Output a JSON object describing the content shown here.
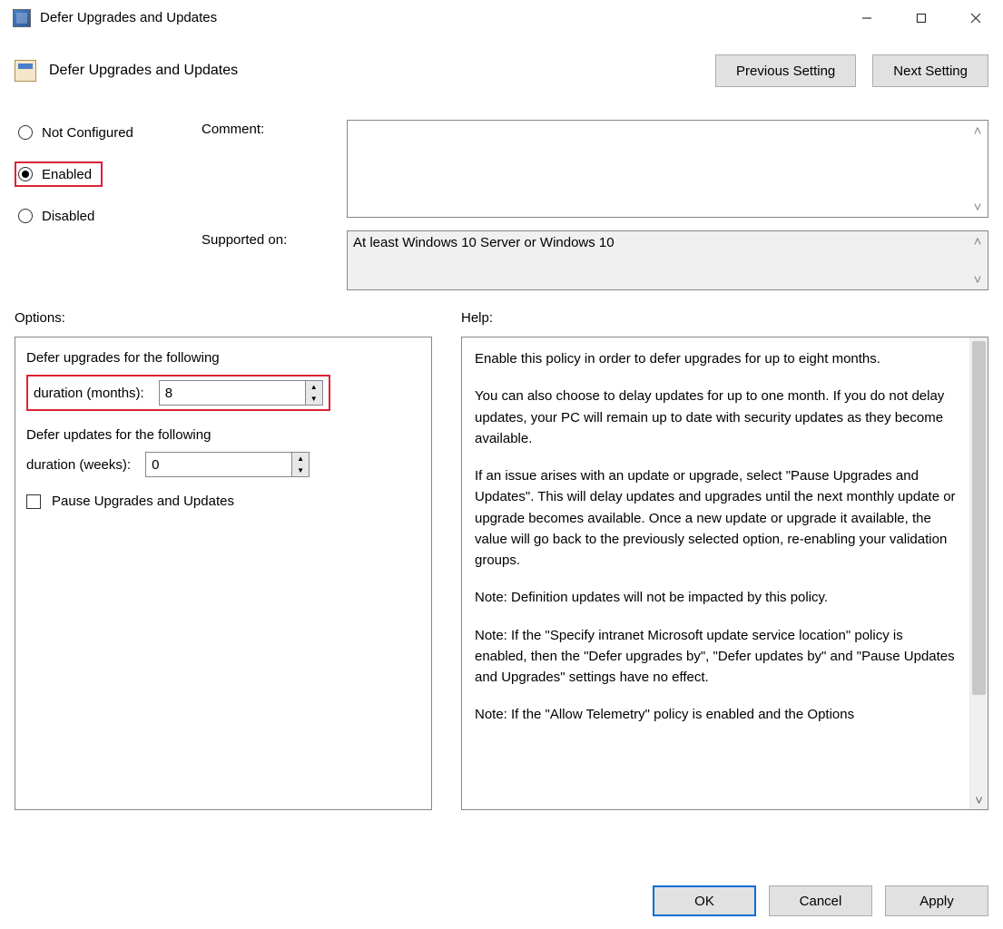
{
  "window": {
    "title": "Defer Upgrades and Updates"
  },
  "setting": {
    "name": "Defer Upgrades and Updates"
  },
  "nav": {
    "prev": "Previous Setting",
    "next": "Next Setting"
  },
  "state": {
    "not_configured": "Not Configured",
    "enabled": "Enabled",
    "disabled": "Disabled",
    "selected": "Enabled"
  },
  "comment": {
    "label": "Comment:",
    "value": ""
  },
  "supported": {
    "label": "Supported on:",
    "value": "At least Windows 10 Server or Windows 10"
  },
  "sections": {
    "options": "Options:",
    "help": "Help:"
  },
  "options": {
    "defer_upgrades_label_1": "Defer upgrades for the following",
    "defer_upgrades_label_2": "duration (months):",
    "defer_upgrades_value": "8",
    "defer_updates_label_1": "Defer updates for the following",
    "defer_updates_label_2": "duration (weeks):",
    "defer_updates_value": "0",
    "pause_label": "Pause Upgrades and Updates",
    "pause_checked": false
  },
  "help": {
    "p1": "Enable this policy in order to defer upgrades for up to eight months.",
    "p2": "You can also choose to delay updates for up to one month. If you do not delay updates, your PC will remain up to date with security updates as they become available.",
    "p3": "If an issue arises with an update or upgrade, select \"Pause Upgrades and Updates\". This will delay updates and upgrades until the next monthly update or upgrade becomes available. Once a new update or upgrade it available, the value will go back to the previously selected option, re-enabling your validation groups.",
    "p4": "Note: Definition updates will not be impacted by this policy.",
    "p5": "Note: If the \"Specify intranet Microsoft update service location\" policy is enabled, then the \"Defer upgrades by\", \"Defer updates by\" and \"Pause Updates and Upgrades\" settings have no effect.",
    "p6": "Note: If the \"Allow Telemetry\" policy is enabled and the Options"
  },
  "buttons": {
    "ok": "OK",
    "cancel": "Cancel",
    "apply": "Apply"
  }
}
